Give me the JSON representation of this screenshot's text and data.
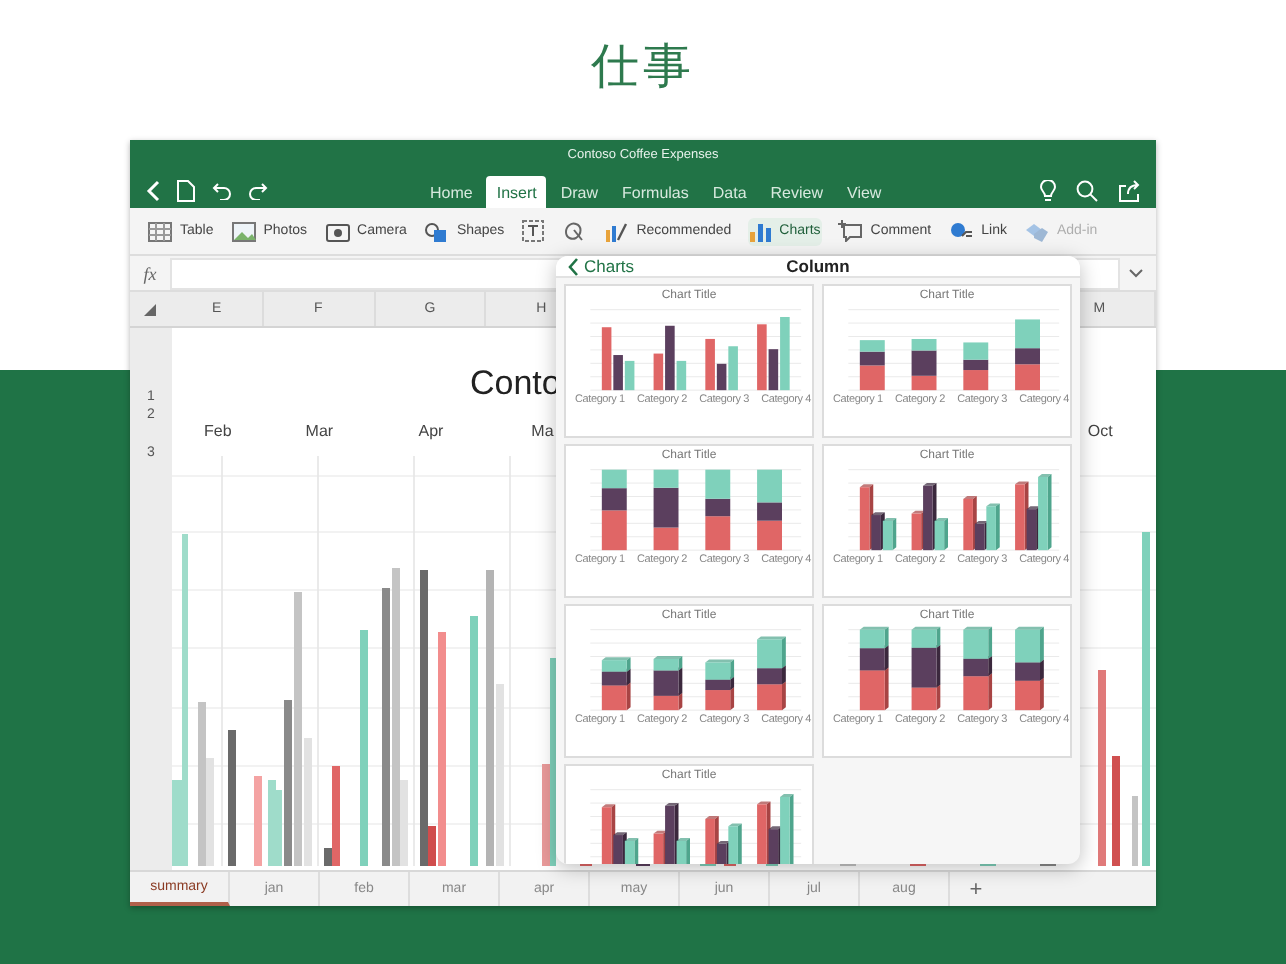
{
  "heading": "仕事",
  "window": {
    "title": "Contoso Coffee Expenses"
  },
  "ribbon_tabs": [
    {
      "label": "Home",
      "selected": false
    },
    {
      "label": "Insert",
      "selected": true
    },
    {
      "label": "Draw",
      "selected": false
    },
    {
      "label": "Formulas",
      "selected": false
    },
    {
      "label": "Data",
      "selected": false
    },
    {
      "label": "Review",
      "selected": false
    },
    {
      "label": "View",
      "selected": false
    }
  ],
  "ribbon_items": [
    {
      "kind": "table",
      "label": "Table",
      "selected": false,
      "disabled": false
    },
    {
      "kind": "photos",
      "label": "Photos",
      "selected": false,
      "disabled": false
    },
    {
      "kind": "camera",
      "label": "Camera",
      "selected": false,
      "disabled": false
    },
    {
      "kind": "shapes",
      "label": "Shapes",
      "selected": false,
      "disabled": false
    },
    {
      "kind": "textbox",
      "selected": false,
      "disabled": false
    },
    {
      "kind": "icons",
      "selected": false,
      "disabled": false
    },
    {
      "kind": "recommended",
      "label": "Recommended",
      "selected": false,
      "disabled": false
    },
    {
      "kind": "charts",
      "label": "Charts",
      "selected": true,
      "disabled": false
    },
    {
      "kind": "comment",
      "label": "Comment",
      "selected": false,
      "disabled": false
    },
    {
      "kind": "link",
      "label": "Link",
      "selected": false,
      "disabled": false
    },
    {
      "kind": "addins",
      "label": "Add-in",
      "selected": false,
      "disabled": true
    }
  ],
  "formula_bar": {
    "label": "fx"
  },
  "columns": [
    "E",
    "F",
    "G",
    "H",
    "M"
  ],
  "rows": [
    "1",
    "2",
    "3"
  ],
  "sheet": {
    "title": "Conto",
    "months": [
      "Feb",
      "Mar",
      "Apr",
      "Ma",
      "Oct"
    ]
  },
  "popover": {
    "back": "Charts",
    "title": "Column",
    "thumbnails": [
      {
        "kind": "clustered",
        "title": "Chart Title",
        "categories": [
          "Category 1",
          "Category 2",
          "Category 3",
          "Category 4"
        ]
      },
      {
        "kind": "stacked",
        "title": "Chart Title",
        "categories": [
          "Category 1",
          "Category 2",
          "Category 3",
          "Category 4"
        ]
      },
      {
        "kind": "percent",
        "title": "Chart Title",
        "categories": [
          "Category 1",
          "Category 2",
          "Category 3",
          "Category 4"
        ]
      },
      {
        "kind": "clustered3d",
        "title": "Chart Title",
        "categories": [
          "Category 1",
          "Category 2",
          "Category 3",
          "Category 4"
        ]
      },
      {
        "kind": "stacked3d",
        "title": "Chart Title",
        "categories": [
          "Category 1",
          "Category 2",
          "Category 3",
          "Category 4"
        ]
      },
      {
        "kind": "percent3d",
        "title": "Chart Title",
        "categories": [
          "Category 1",
          "Category 2",
          "Category 3",
          "Category 4"
        ]
      },
      {
        "kind": "clustered3d",
        "title": "Chart Title"
      }
    ]
  },
  "sheet_tabs": [
    {
      "label": "summary",
      "selected": true
    },
    {
      "label": "jan",
      "selected": false
    },
    {
      "label": "feb",
      "selected": false
    },
    {
      "label": "mar",
      "selected": false
    },
    {
      "label": "apr",
      "selected": false
    },
    {
      "label": "may",
      "selected": false
    },
    {
      "label": "jun",
      "selected": false
    },
    {
      "label": "jul",
      "selected": false
    },
    {
      "label": "aug",
      "selected": false
    }
  ],
  "add_sheet": "+"
}
